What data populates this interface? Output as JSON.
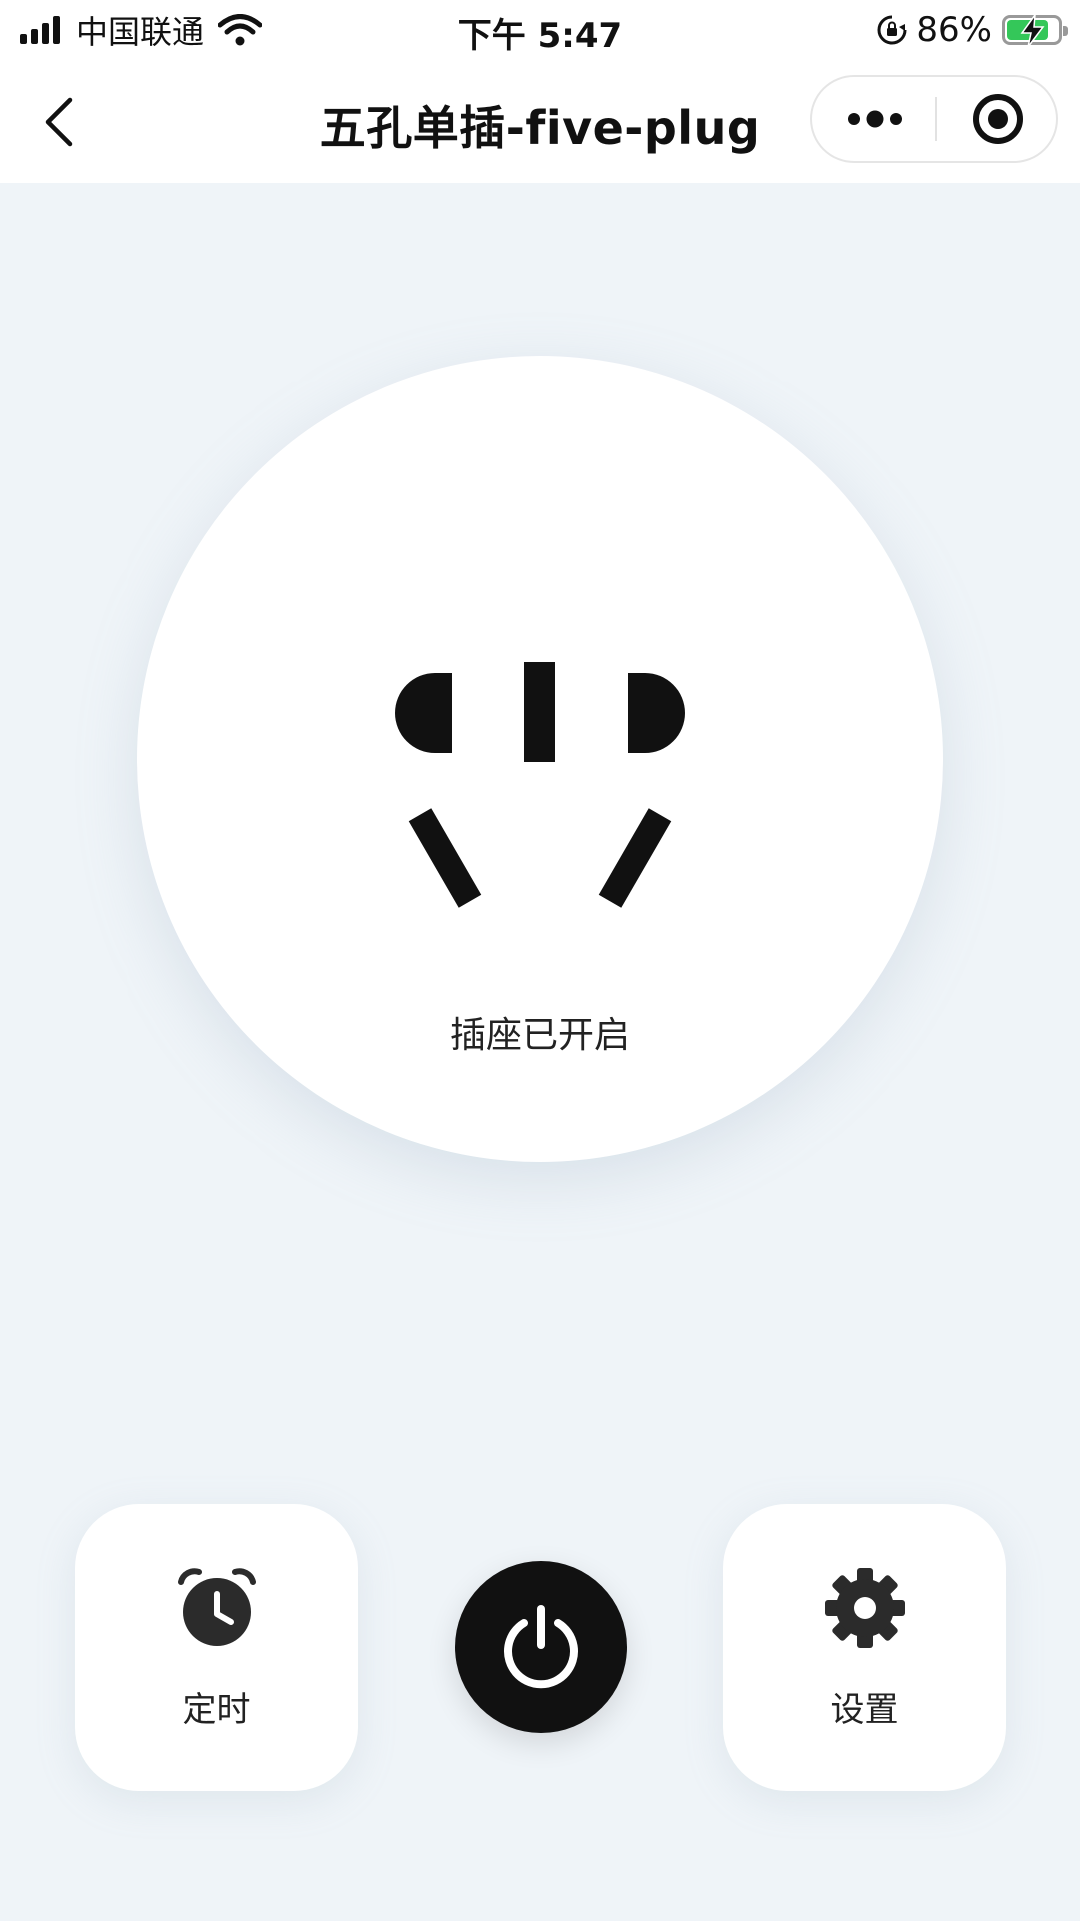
{
  "status_bar": {
    "carrier": "中国联通",
    "time": "下午 5:47",
    "battery_percent": "86%",
    "battery_level": 0.86,
    "icons": [
      "signal-icon",
      "wifi-icon",
      "rotation-lock-icon",
      "battery-charging-icon"
    ]
  },
  "nav": {
    "title": "五孔单插-five-plug",
    "icons": [
      "back-icon",
      "more-icon",
      "target-icon"
    ]
  },
  "socket": {
    "status": "插座已开启",
    "icon": "five-pin-socket-icon"
  },
  "actions": {
    "timer_label": "定时",
    "settings_label": "设置",
    "power_icon": "power-icon"
  },
  "colors": {
    "background": "#eff4f8",
    "dark": "#111111",
    "battery_green": "#34c759"
  }
}
